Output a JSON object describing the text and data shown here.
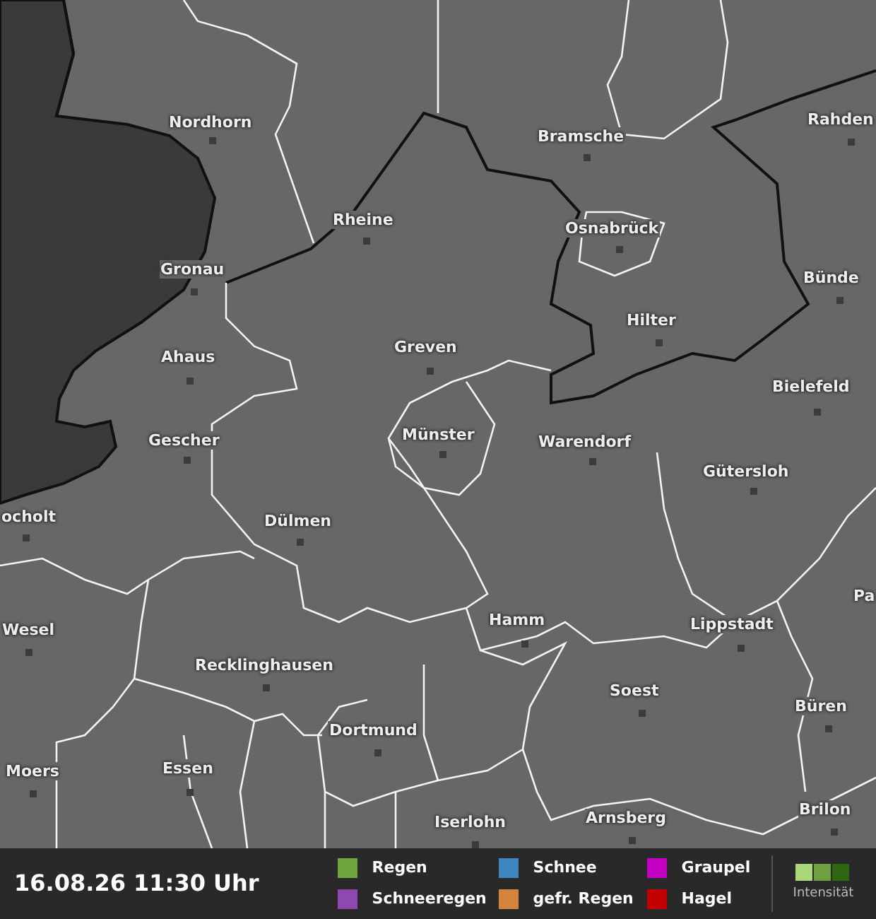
{
  "map": {
    "cities": [
      {
        "name": "Nordhorn"
      },
      {
        "name": "Bramsche"
      },
      {
        "name": "Rahden"
      },
      {
        "name": "Rheine"
      },
      {
        "name": "Osnabrück"
      },
      {
        "name": "Gronau"
      },
      {
        "name": "Bünde"
      },
      {
        "name": "Hilter"
      },
      {
        "name": "Greven"
      },
      {
        "name": "Ahaus"
      },
      {
        "name": "Bielefeld"
      },
      {
        "name": "Gescher"
      },
      {
        "name": "Münster"
      },
      {
        "name": "Warendorf"
      },
      {
        "name": "Gütersloh"
      },
      {
        "name": "ocholt"
      },
      {
        "name": "Dülmen"
      },
      {
        "name": "Pa"
      },
      {
        "name": "Wesel"
      },
      {
        "name": "Hamm"
      },
      {
        "name": "Lippstadt"
      },
      {
        "name": "Recklinghausen"
      },
      {
        "name": "Soest"
      },
      {
        "name": "Büren"
      },
      {
        "name": "Dortmund"
      },
      {
        "name": "Moers"
      },
      {
        "name": "Essen"
      },
      {
        "name": "Iserlohn"
      },
      {
        "name": "Arnsberg"
      },
      {
        "name": "Brilon"
      }
    ]
  },
  "footer": {
    "timestamp": "16.08.26 11:30 Uhr",
    "legend": [
      {
        "label": "Regen",
        "color": "#6fa53f"
      },
      {
        "label": "Schneeregen",
        "color": "#8e48b0"
      },
      {
        "label": "Schnee",
        "color": "#3f86c0"
      },
      {
        "label": "gefr. Regen",
        "color": "#d5843c"
      },
      {
        "label": "Graupel",
        "color": "#c400c4"
      },
      {
        "label": "Hagel",
        "color": "#c40000"
      }
    ],
    "intensity": {
      "label": "Intensität",
      "swatches": [
        {
          "color": "#a8d878"
        },
        {
          "color": "#6fa040"
        },
        {
          "color": "#2f6612"
        }
      ]
    }
  }
}
